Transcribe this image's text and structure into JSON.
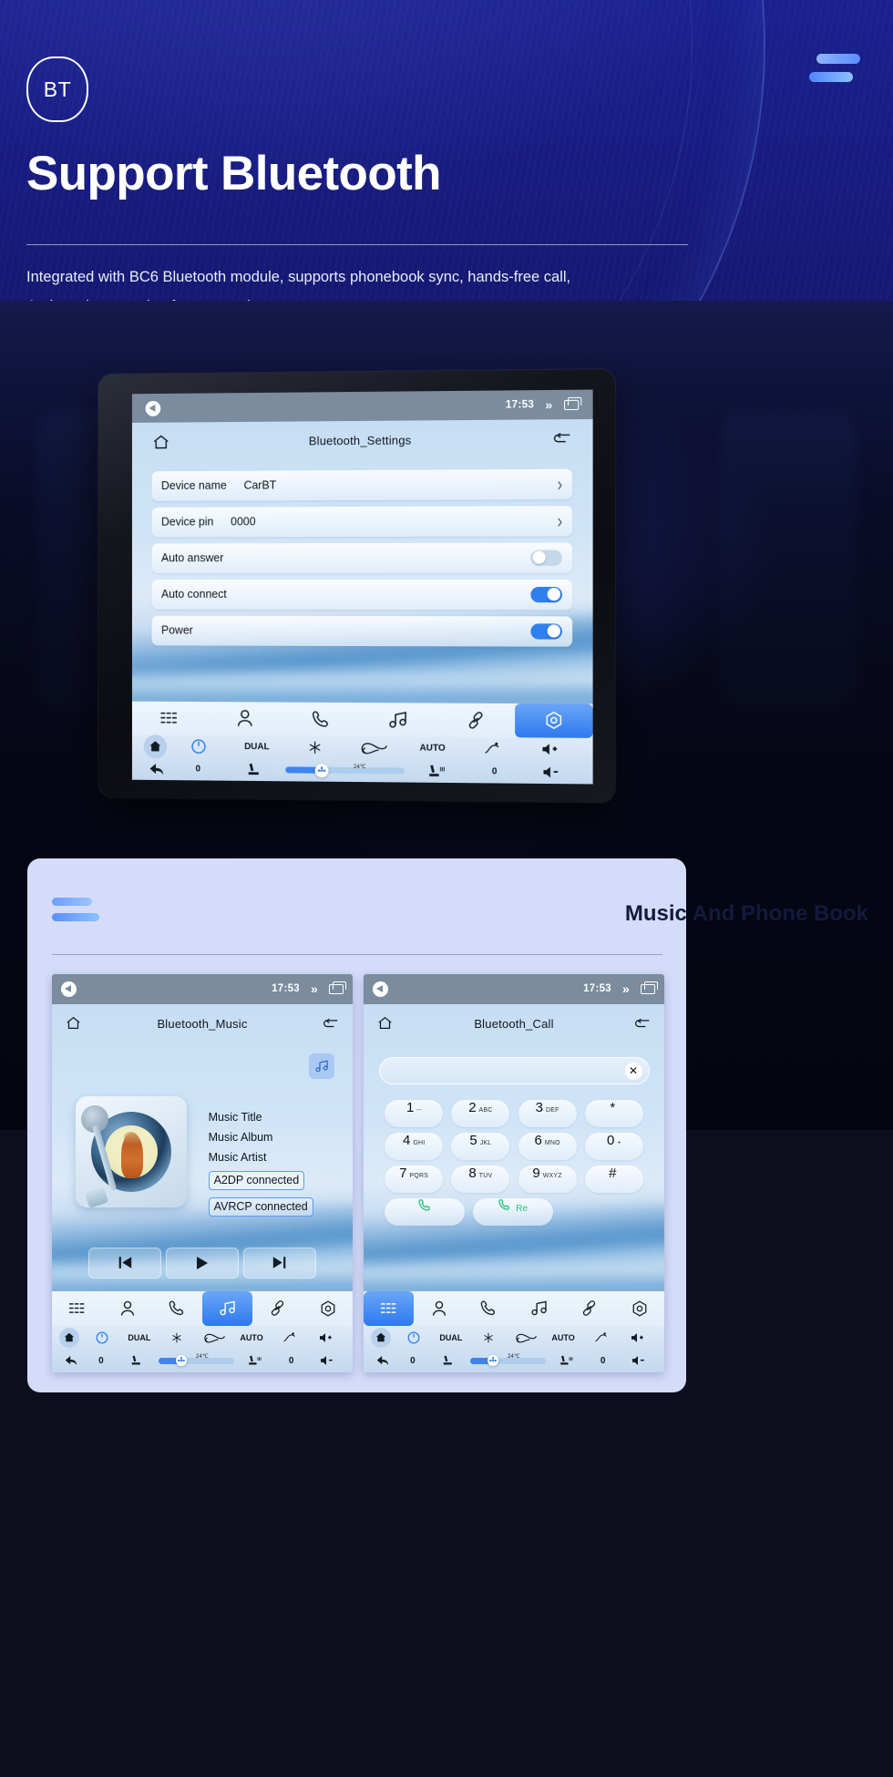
{
  "hero": {
    "badge": "BT",
    "title": "Support Bluetooth",
    "subtitle_line1": "Integrated with BC6 Bluetooth module, supports phonebook sync, hands-free call,",
    "subtitle_line2": "And music streaming from your phone.",
    "menu_icon": "hamburger-icon"
  },
  "settings_screen": {
    "statusbar": {
      "time": "17:53",
      "back_icon": "back-circle-icon",
      "chevron_icon": "chevron-up-icon",
      "recents_icon": "recents-icon"
    },
    "home_icon": "home-icon",
    "title": "Bluetooth_Settings",
    "back_icon": "return-arrow-icon",
    "rows": [
      {
        "label": "Device name",
        "value": "CarBT",
        "control": "chevron",
        "chevron": "›"
      },
      {
        "label": "Device pin",
        "value": "0000",
        "control": "chevron",
        "chevron": "›"
      },
      {
        "label": "Auto answer",
        "value": "",
        "control": "toggle",
        "state": "off"
      },
      {
        "label": "Auto connect",
        "value": "",
        "control": "toggle",
        "state": "on"
      },
      {
        "label": "Power",
        "value": "",
        "control": "toggle",
        "state": "on"
      }
    ],
    "dock": [
      {
        "icon": "apps-grid-icon",
        "selected": false
      },
      {
        "icon": "contact-person-icon",
        "selected": false
      },
      {
        "icon": "phone-handset-icon",
        "selected": false
      },
      {
        "icon": "music-note-icon",
        "selected": false
      },
      {
        "icon": "link-chain-icon",
        "selected": false
      },
      {
        "icon": "settings-hex-icon",
        "selected": true
      }
    ],
    "hvac": {
      "home_icon": "home-fill-icon",
      "power_icon": "power-icon",
      "dual_label": "DUAL",
      "snow_icon": "snowflake-icon",
      "recirculate_icon": "air-recirculation-icon",
      "auto_label": "AUTO",
      "defrost_icon": "rear-defrost-icon",
      "vol_up_label": "+",
      "vol_down_label": "−",
      "back_icon": "back-arrow-icon",
      "left_temp": "0",
      "right_temp": "0",
      "seat_icon": "seat-icon",
      "seat_heat_icon": "heated-seat-icon",
      "temp_label": "24℃",
      "fan_icon": "fan-icon"
    }
  },
  "card": {
    "title": "Music And Phone Book",
    "menu_icon": "hamburger-icon"
  },
  "music_screen": {
    "statusbar": {
      "time": "17:53"
    },
    "title": "Bluetooth_Music",
    "meta": {
      "music_title": "Music Title",
      "music_album": "Music Album",
      "music_artist": "Music Artist",
      "chip_a2dp": "A2DP  connected",
      "chip_avrcp": "AVRCP connected"
    },
    "fab_icon": "music-note-icon",
    "transport": [
      {
        "icon": "previous-track-icon",
        "glyph": "⏮"
      },
      {
        "icon": "play-icon",
        "glyph": "▶"
      },
      {
        "icon": "next-track-icon",
        "glyph": "⏭"
      }
    ],
    "dock_selected_index": 3
  },
  "call_screen": {
    "statusbar": {
      "time": "17:53"
    },
    "title": "Bluetooth_Call",
    "search": {
      "value": "",
      "placeholder": "",
      "clear_label": "✕"
    },
    "keys": [
      {
        "n": "1",
        "s": "--"
      },
      {
        "n": "2",
        "s": "ABC"
      },
      {
        "n": "3",
        "s": "DEF"
      },
      {
        "n": "*",
        "s": ""
      },
      {
        "n": "4",
        "s": "GHI"
      },
      {
        "n": "5",
        "s": "JKL"
      },
      {
        "n": "6",
        "s": "MNO"
      },
      {
        "n": "0",
        "s": "+"
      },
      {
        "n": "7",
        "s": "PQRS"
      },
      {
        "n": "8",
        "s": "TUV"
      },
      {
        "n": "9",
        "s": "WXYZ"
      },
      {
        "n": "#",
        "s": ""
      }
    ],
    "actions": [
      {
        "icon": "call-icon",
        "label": ""
      },
      {
        "icon": "redial-icon",
        "label": "Re"
      }
    ],
    "dock_selected_index": 0
  },
  "colors": {
    "hero_bg": "#1a2090",
    "accent_blue": "#2f7ff0",
    "card_bg": "#d4dcfa",
    "statusbar": "#7a8c9e",
    "green": "#2ec27e"
  }
}
